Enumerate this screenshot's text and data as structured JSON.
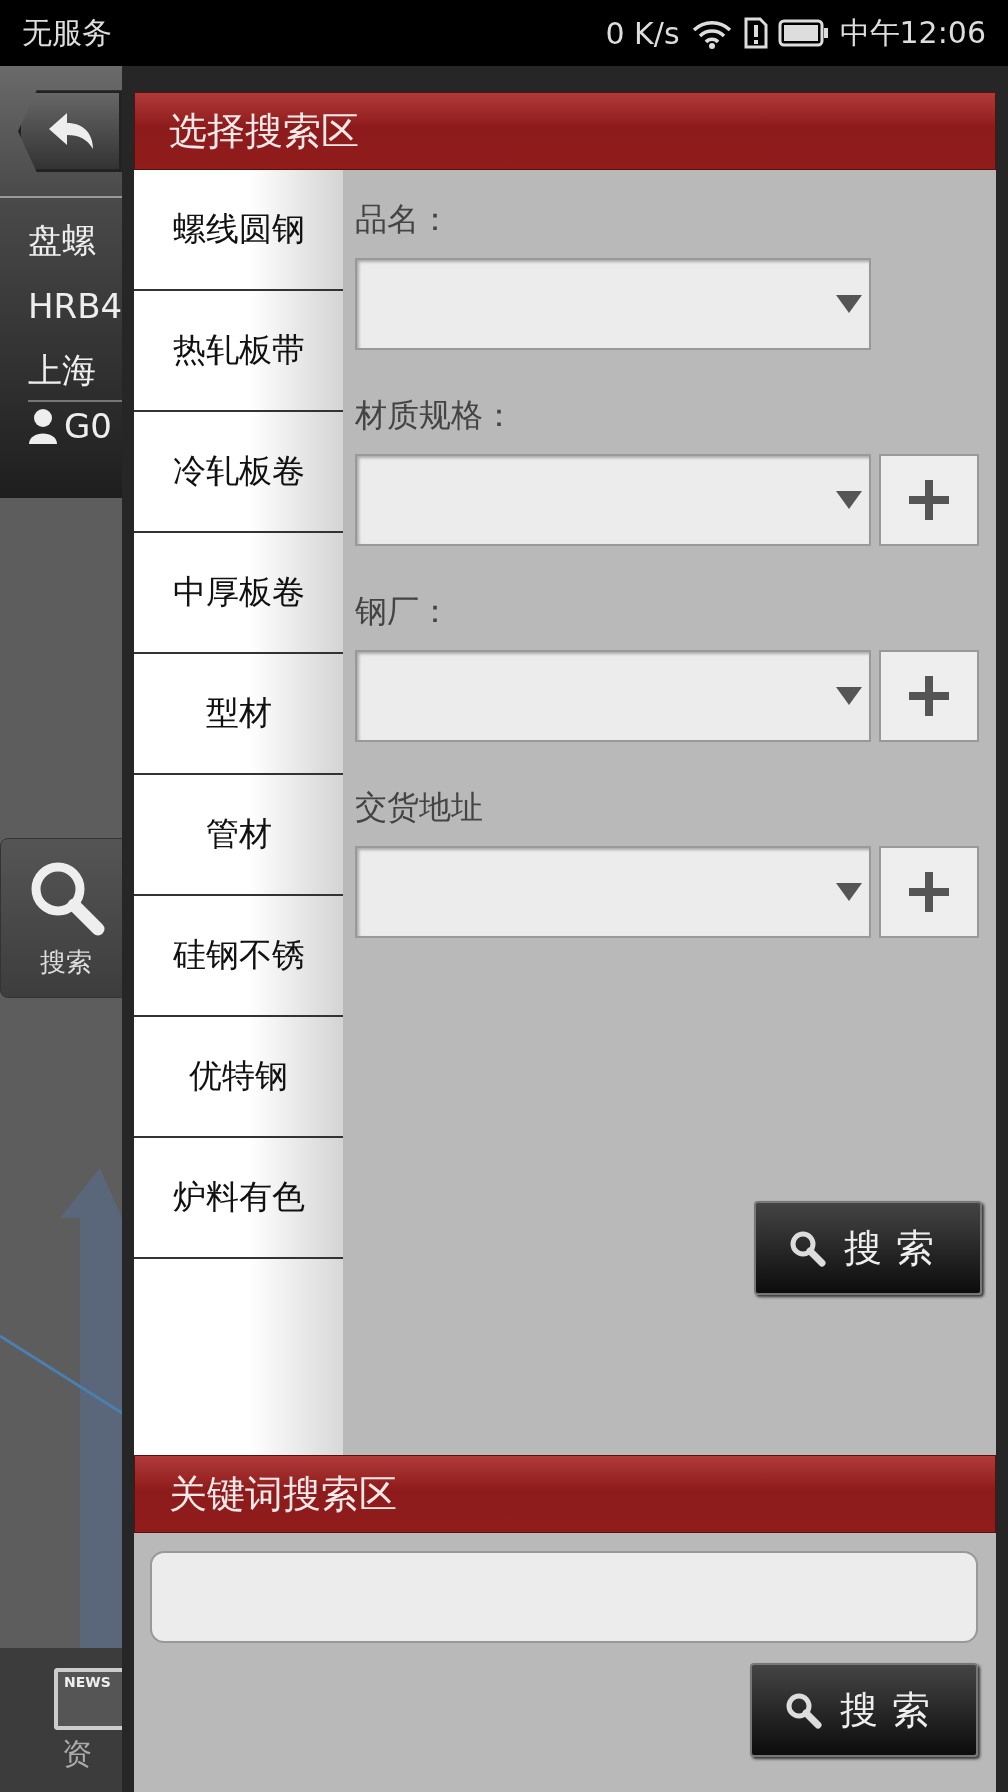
{
  "status_bar": {
    "carrier": "无服务",
    "speed": "0 K/s",
    "time": "中午12:06"
  },
  "background_app": {
    "info": [
      "盘螺",
      "HRB4",
      "上海"
    ],
    "user": "G0",
    "side_button": "搜索",
    "news_badge": "NEWS",
    "nav_label": "资"
  },
  "dialog": {
    "title": "选择搜索区",
    "categories": [
      "螺线圆钢",
      "热轧板带",
      "冷轧板卷",
      "中厚板卷",
      "型材",
      "管材",
      "硅钢不锈",
      "优特钢",
      "炉料有色"
    ],
    "fields": [
      {
        "label": "品名：",
        "has_add": false
      },
      {
        "label": "材质规格：",
        "has_add": true
      },
      {
        "label": "钢厂：",
        "has_add": true
      },
      {
        "label": "交货地址",
        "has_add": true
      }
    ],
    "search_button": "搜索",
    "keyword_title": "关键词搜索区",
    "keyword_button": "搜索"
  }
}
